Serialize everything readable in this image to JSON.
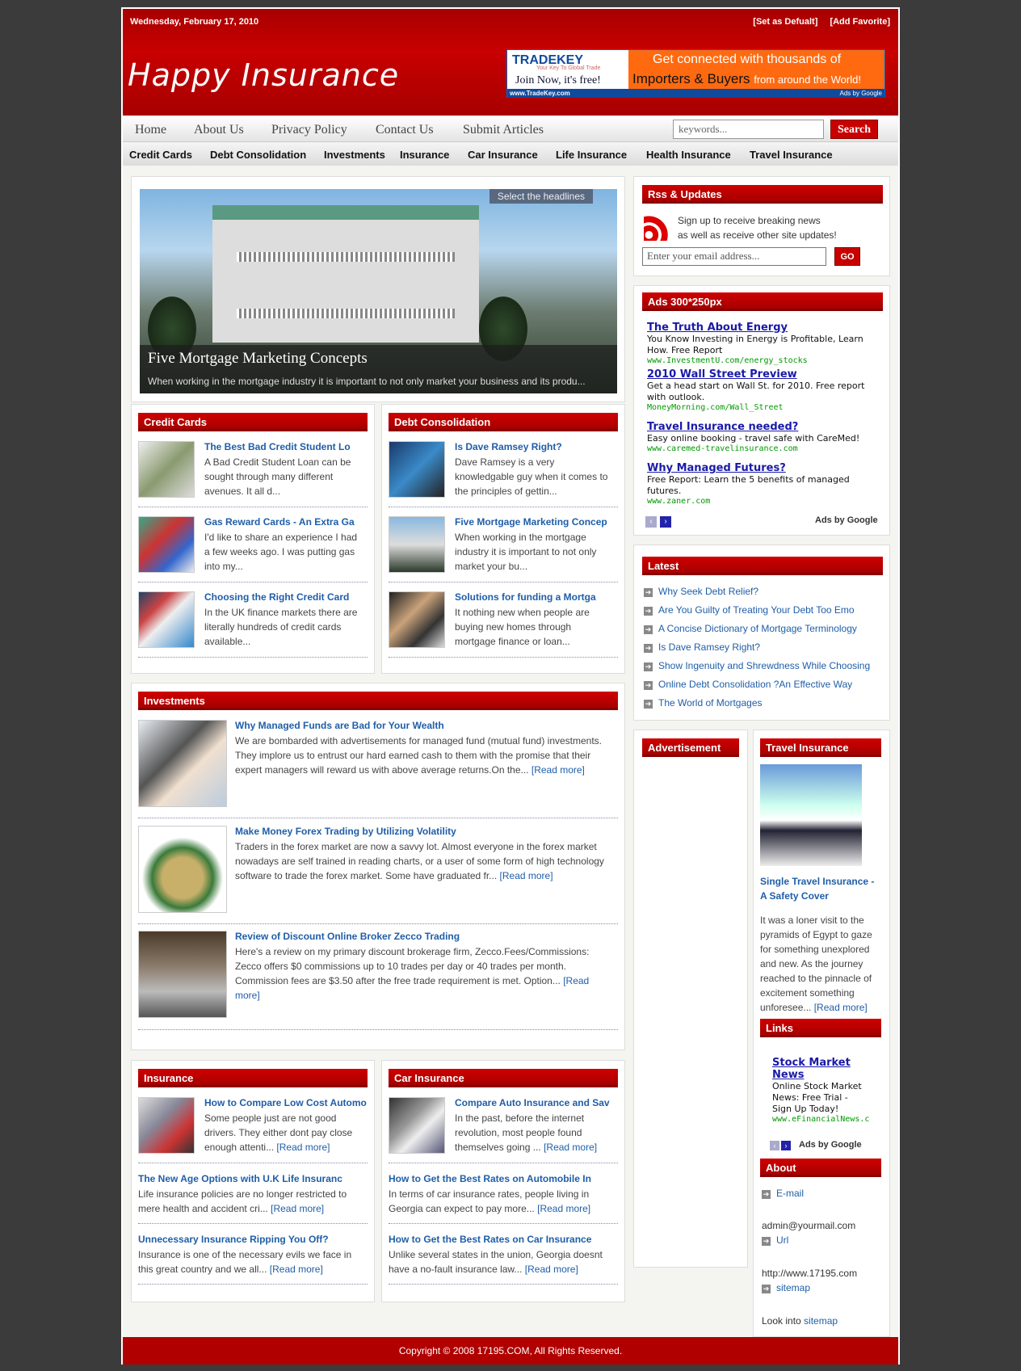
{
  "header": {
    "date": "Wednesday, February 17, 2010",
    "set_default": "[Set as Defualt]",
    "add_favorite": "[Add Favorite]",
    "site_title": "Happy Insurance"
  },
  "banner": {
    "brand": "TRADEKEY",
    "tagline": "Your Key To Global Trade",
    "join": "Join Now, it's free!",
    "line1": "Get connected with thousands of",
    "line2": "Importers & Buyers",
    "line2b": "from around the World!",
    "url": "www.TradeKey.com",
    "ads": "Ads by Google"
  },
  "nav": {
    "main": [
      "Home",
      "About Us",
      "Privacy Policy",
      "Contact Us",
      "Submit Articles"
    ],
    "search_placeholder": "keywords...",
    "search_button": "Search",
    "categories": [
      "Credit Cards",
      "Debt Consolidation",
      "Investments",
      "Insurance",
      "Car Insurance",
      "Life Insurance",
      "Health Insurance",
      "Travel Insurance"
    ]
  },
  "slider": {
    "select_label": "Select the headlines",
    "title": "Five Mortgage Marketing Concepts",
    "desc": "When working in the mortgage industry it is important to not only market your business and its produ..."
  },
  "credit_cards": {
    "title": "Credit Cards",
    "posts": [
      {
        "title": "The Best Bad Credit Student Lo",
        "desc": [
          "A Bad Credit Student Loan can be",
          "sought through many different",
          "avenues. It all d..."
        ]
      },
      {
        "title": "Gas Reward Cards - An Extra Ga",
        "desc": [
          "I'd like to share an experience I had",
          "a few weeks ago. I was putting gas",
          "into my..."
        ]
      },
      {
        "title": "Choosing the Right Credit Card",
        "desc": [
          "In the UK finance markets there are",
          "literally hundreds of credit cards",
          "available..."
        ]
      }
    ]
  },
  "debt": {
    "title": "Debt Consolidation",
    "posts": [
      {
        "title": "Is Dave Ramsey Right?",
        "desc": [
          "Dave Ramsey is a very",
          "knowledgable guy when it comes to",
          "the principles of gettin..."
        ]
      },
      {
        "title": "Five Mortgage Marketing Concep",
        "desc": [
          "When working in the mortgage",
          "industry it is important to not only",
          "market your bu..."
        ]
      },
      {
        "title": "Solutions for funding a Mortga",
        "desc": [
          "It nothing new when people are",
          "buying new homes through",
          "mortgage finance or loan..."
        ]
      }
    ]
  },
  "investments": {
    "title": "Investments",
    "read_more": "[Read more]",
    "posts": [
      {
        "title": "Why Managed Funds are Bad for Your Wealth",
        "desc": [
          "We are bombarded with advertisements for managed fund (mutual fund) investments.",
          "They implore us to entrust our hard earned cash to them with the promise that their",
          "expert managers will reward us with above average returns.On the..."
        ]
      },
      {
        "title": "Make Money Forex Trading by Utilizing Volatility",
        "desc": [
          "Traders in the forex market are now a savvy lot. Almost everyone in the forex market",
          "nowadays are self trained in reading charts, or a user of some form of high technology",
          "software to trade the forex market. Some have graduated fr..."
        ]
      },
      {
        "title": "Review of Discount Online Broker Zecco Trading",
        "desc": [
          "Here's a review on my primary discount brokerage firm, Zecco.Fees/Commissions:",
          "Zecco offers $0 commissions up to 10 trades per day or 40 trades per month.",
          "Commission fees are $3.50 after the free trade requirement is met. Option..."
        ]
      }
    ]
  },
  "insurance": {
    "title": "Insurance",
    "read_more": "[Read more]",
    "posts": [
      {
        "title": "How to Compare Low Cost Automo",
        "desc": [
          "Some people just are not good",
          "drivers. They either dont pay close",
          "enough attenti..."
        ]
      },
      {
        "title": "The New Age Options with U.K Life Insuranc",
        "desc": [
          "Life insurance policies are no longer restricted to",
          "mere health and accident cri..."
        ]
      },
      {
        "title": "Unnecessary Insurance Ripping You Off?",
        "desc": [
          "Insurance is one of the necessary evils we face in",
          "this great country and we all..."
        ]
      }
    ]
  },
  "car": {
    "title": "Car Insurance",
    "read_more": "[Read more]",
    "posts": [
      {
        "title": "Compare Auto Insurance and Sav",
        "desc": [
          "In the past, before the internet",
          "revolution, most people found",
          "themselves going ..."
        ]
      },
      {
        "title": "How to Get the Best Rates on Automobile In",
        "desc": [
          "In terms of car insurance rates, people living in",
          "Georgia can expect to pay more..."
        ]
      },
      {
        "title": "How to Get the Best Rates on Car Insurance",
        "desc": [
          "Unlike several states in the union, Georgia doesnt",
          "have a no-fault insurance law..."
        ]
      }
    ]
  },
  "rss": {
    "title": "Rss & Updates",
    "text1": "Sign up to receive breaking news",
    "text2": "as well as receive other site updates!",
    "email_placeholder": "Enter your email address...",
    "go": "GO"
  },
  "ads": {
    "title": "Ads 300*250px",
    "items": [
      {
        "t": "The Truth About Energy",
        "d": [
          "You Know Investing in Energy is Profitable, Learn",
          "How. Free Report"
        ],
        "u": "www.InvestmentU.com/energy_stocks"
      },
      {
        "t": "2010 Wall Street Preview",
        "d": [
          "Get a head start on Wall St. for 2010. Free report",
          "with outlook."
        ],
        "u": "MoneyMorning.com/Wall_Street"
      },
      {
        "t": "Travel Insurance needed?",
        "d": [
          "Easy online booking - travel safe with CareMed!"
        ],
        "u": "www.caremed-travelinsurance.com"
      },
      {
        "t": "Why Managed Futures?",
        "d": [
          "Free Report: Learn the 5 benefits of managed",
          "futures."
        ],
        "u": "www.zaner.com"
      }
    ],
    "ads_by": "Ads by Google"
  },
  "latest": {
    "title": "Latest",
    "items": [
      "Why Seek Debt Relief?",
      "Are You Guilty of Treating Your Debt Too Emo",
      "A Concise Dictionary of Mortgage Terminology",
      "Is Dave Ramsey Right?",
      "Show Ingenuity and Shrewdness While Choosing",
      "Online Debt Consolidation ?An Effective Way",
      "The World of Mortgages"
    ]
  },
  "advertisement": {
    "title": "Advertisement"
  },
  "travel": {
    "title": "Travel Insurance",
    "post_title": [
      "Single Travel Insurance -",
      "A Safety Cover"
    ],
    "desc": [
      "It was a loner visit to the",
      "pyramids of Egypt to gaze",
      "for something unexplored",
      "and new. As the journey",
      "reached to the pinnacle of",
      "excitement something",
      "unforesee..."
    ],
    "read_more": "[Read more]"
  },
  "links": {
    "title": "Links",
    "ad_title": [
      "Stock Market",
      "News"
    ],
    "ad_desc": [
      "Online Stock Market",
      "News: Free Trial -",
      "Sign Up Today!"
    ],
    "ad_url": "www.eFinancialNews.c",
    "ads_by": "Ads by Google"
  },
  "about": {
    "title": "About",
    "email_label": "E-mail",
    "email": "admin@yourmail.com",
    "url_label": "Url",
    "url": "http://www.17195.com",
    "sitemap_label": "sitemap",
    "look": "Look into",
    "look_link": "sitemap"
  },
  "footer": {
    "copyright": "Copyright © 2008 17195.COM, All Rights Reserved."
  },
  "colors": {
    "brand_red": "#c80000",
    "link_blue": "#1f5ea8",
    "page_bg": "#3b3b3b"
  }
}
